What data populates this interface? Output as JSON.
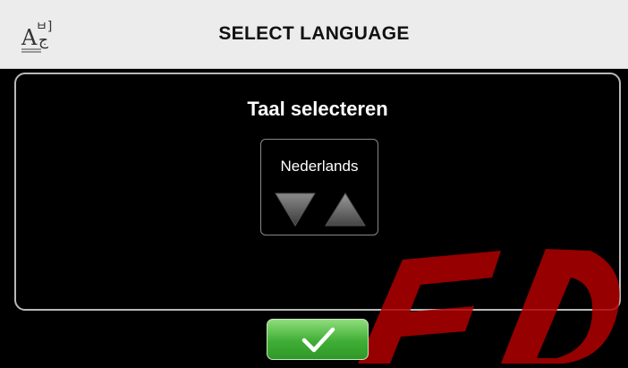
{
  "header": {
    "icon": "language-icon",
    "title": "SELECT LANGUAGE"
  },
  "panel": {
    "title": "Taal selecteren",
    "picker": {
      "value": "Nederlands",
      "down_icon": "triangle-down-icon",
      "up_icon": "triangle-up-icon"
    }
  },
  "footer": {
    "confirm_icon": "checkmark-icon"
  },
  "watermark": {
    "text": "ED",
    "color": "#c00000"
  },
  "colors": {
    "header_bg": "#ececec",
    "panel_border": "#b8b8b8",
    "confirm_green": "#3fae35"
  }
}
